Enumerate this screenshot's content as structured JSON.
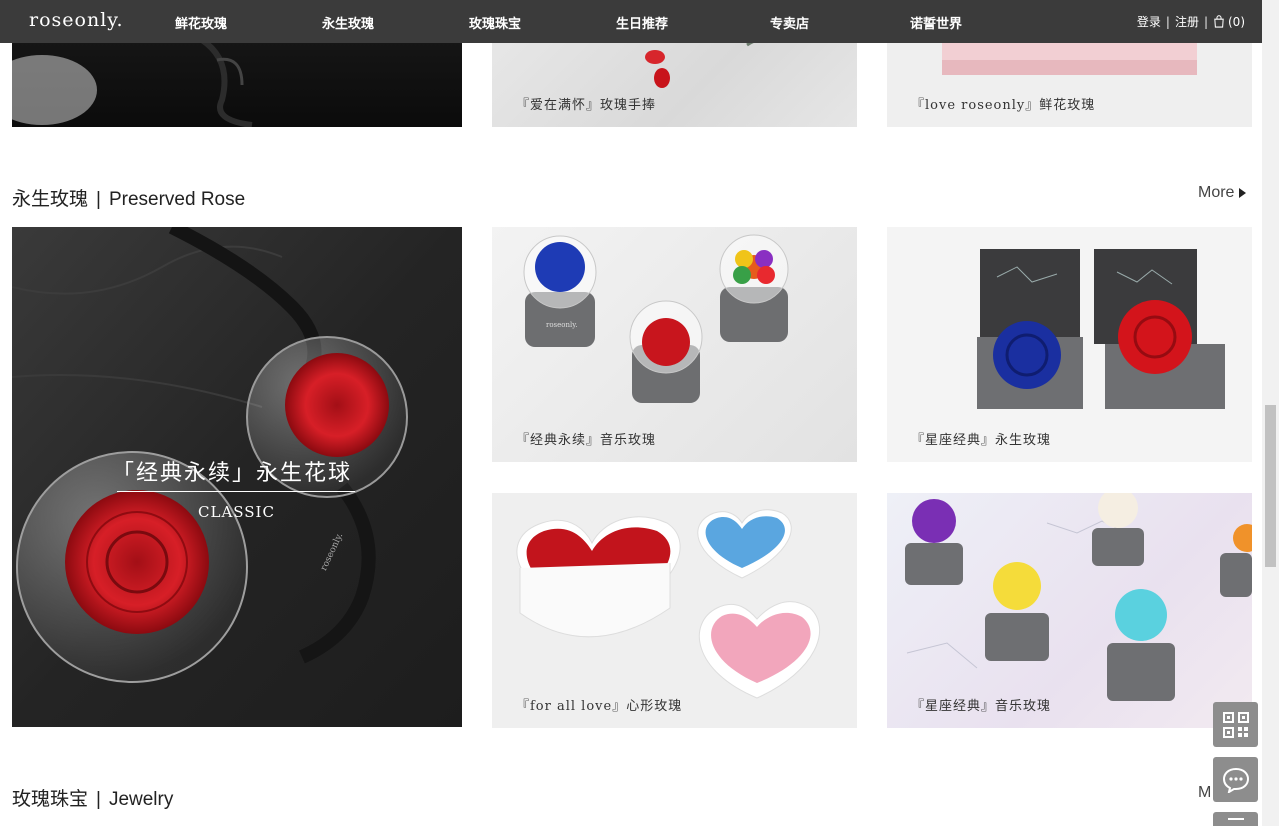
{
  "brand": {
    "logo_text": "roseonly."
  },
  "nav": {
    "items": [
      "鲜花玫瑰",
      "永生玫瑰",
      "玫瑰珠宝",
      "生日推荐",
      "专卖店",
      "诺誓世界"
    ],
    "login": "登录",
    "register": "注册",
    "cart_count": "(0)"
  },
  "top_row": {
    "captions": [
      "『爱在满怀』玫瑰手捧",
      "『love roseonly』鲜花玫瑰"
    ]
  },
  "preserved_section": {
    "title_cn": "永生玫瑰",
    "title_en": "Preserved Rose",
    "more": "More",
    "feature": {
      "headline": "「经典永续」永生花球",
      "subline": "CLASSIC",
      "product_text": "roseonly."
    },
    "tiles": [
      {
        "caption": "『经典永续』音乐玫瑰",
        "product_text": "roseonly."
      },
      {
        "caption": "『星座经典』永生玫瑰"
      },
      {
        "caption": "『for all love』心形玫瑰"
      },
      {
        "caption": "『星座经典』音乐玫瑰"
      }
    ]
  },
  "jewelry_section": {
    "title_cn": "玫瑰珠宝",
    "title_en": "Jewelry",
    "more_partial": "M"
  },
  "floating": {
    "qr_icon": "qr-code-icon",
    "chat_icon": "chat-bubble-icon",
    "menu_icon": "menu-icon"
  }
}
